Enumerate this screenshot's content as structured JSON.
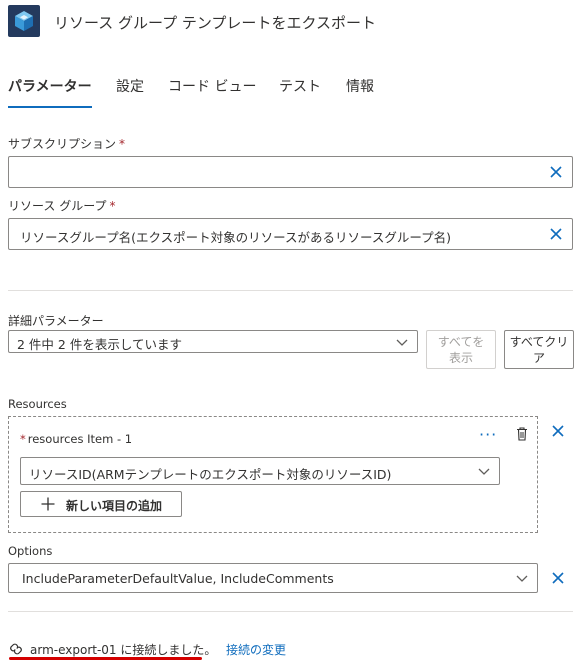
{
  "header": {
    "title": "リソース グループ テンプレートをエクスポート",
    "icon": "resource-group-cube-icon"
  },
  "tabs": [
    {
      "label": "パラメーター",
      "active": true
    },
    {
      "label": "設定",
      "active": false
    },
    {
      "label": "コード ビュー",
      "active": false
    },
    {
      "label": "テスト",
      "active": false
    },
    {
      "label": "情報",
      "active": false
    }
  ],
  "subscription": {
    "label": "サブスクリプション",
    "required": "*",
    "value": ""
  },
  "resource_group": {
    "label": "リソース グループ",
    "required": "*",
    "value": "リソースグループ名(エクスポート対象のリソースがあるリソースグループ名)"
  },
  "advanced": {
    "label": "詳細パラメーター",
    "selected": "2 件中 2 件を表示しています",
    "show_all_label": "すべてを\n表示",
    "clear_all_label": "すべてクリア"
  },
  "resources": {
    "label": "Resources",
    "item_label": "resources Item - 1",
    "item_required": "*",
    "item_value": "リソースID(ARMテンプレートのエクスポート対象のリソースID)",
    "add_label": "新しい項目の追加"
  },
  "options": {
    "label": "Options",
    "value": "IncludeParameterDefaultValue, IncludeComments"
  },
  "footer": {
    "connection_text": "arm-export-01 に接続しました。",
    "change_link": "接続の変更"
  },
  "colors": {
    "accent": "#0f6cbd",
    "required": "#a4262c",
    "highlight_underline": "#d40000",
    "logo_bg": "#243a5e"
  }
}
